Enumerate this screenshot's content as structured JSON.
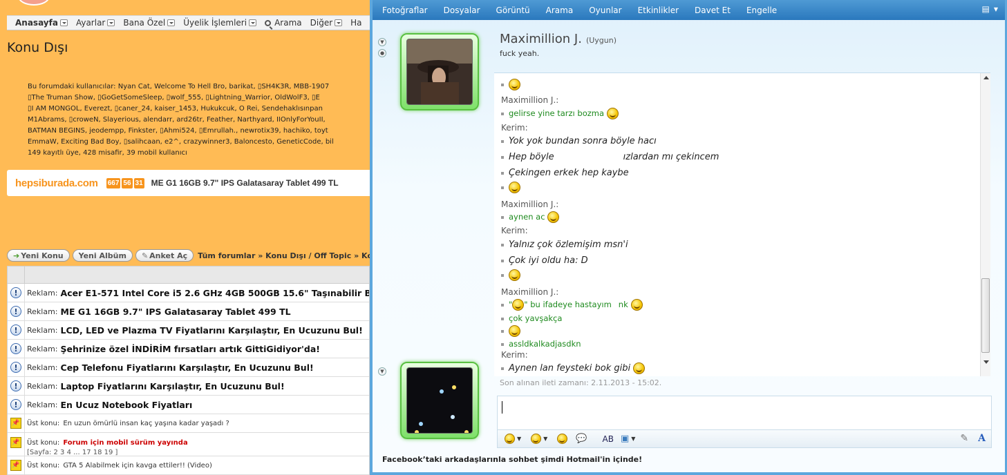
{
  "forum": {
    "nav": [
      {
        "label": "Anasayfa"
      },
      {
        "label": "Ayarlar"
      },
      {
        "label": "Bana Özel"
      },
      {
        "label": "Üyelik İşlemleri"
      },
      {
        "label": "Arama"
      },
      {
        "label": "Diğer"
      },
      {
        "label": "Ha"
      }
    ],
    "page_title": "Konu Dışı",
    "online_label": "Bu forumdaki kullanıcılar:",
    "online_lines": [
      "Nyan Cat, Welcome To Hell Bro, barikat, ▯SH4K3R, MBB-1907",
      "▯The Truman Show, ▯GoGetSomeSleep, ▯wolf_555, ▯Lightning_Warrior, OldWolF3, ▯E",
      "▯I AM MONGOL, Everezt, ▯caner_24, kaiser_1453, Hukukcuk, O Rei, Sendehaklısınpan",
      "M1Abrams, ▯croweN, Slayerious, alendarr, ard26tr, Feather, Narthyard, IIOnlyForYouII,",
      "BATMAN BEGINS, jeodempp, Finkster, ▯Ahmi524, ▯Emrullah., newrotix39, hachiko, toyt",
      "EmmaW, Exciting Bad Boy, ▯salihcaan, e2^, crazywinner3, Baloncesto, GeneticCode, bil",
      "149 kayıtlı üye, 428 misafir, 39 mobil kullanıcı"
    ],
    "ad": {
      "logo": "hepsiburada.com",
      "timer": [
        "667",
        "56",
        "31"
      ],
      "text": "ME G1 16GB 9.7\" IPS Galatasaray Tablet 499 TL"
    },
    "buttons": {
      "new_topic": "Yeni Konu",
      "new_album": "Yeni Albüm",
      "poll": "Anket Aç"
    },
    "breadcrumb": "Tüm forumlar » Konu Dışı / Off Topic » Kon",
    "ad_rows": [
      {
        "label": "Reklam:",
        "title": "Acer E1-571 Intel Core i5 2.6 GHz 4GB 500GB 15.6\" Taşınabilir Bi"
      },
      {
        "label": "Reklam:",
        "title": "ME G1 16GB 9.7\" IPS Galatasaray Tablet 499 TL"
      },
      {
        "label": "Reklam:",
        "title": "LCD, LED ve Plazma TV Fiyatlarını Karşılaştır, En Ucuzunu Bul!"
      },
      {
        "label": "Reklam:",
        "title": "Şehrinize özel İNDİRİM fırsatları artık GittiGidiyor'da!"
      },
      {
        "label": "Reklam:",
        "title": "Cep Telefonu Fiyatlarını Karşılaştır, En Ucuzunu Bul!"
      },
      {
        "label": "Reklam:",
        "title": "Laptop Fiyatlarını Karşılaştır, En Ucuzunu Bul!"
      },
      {
        "label": "Reklam:",
        "title": "En Ucuz Notebook Fiyatları"
      }
    ],
    "sticky_rows": [
      {
        "label": "Üst konu:",
        "title": "En uzun ömürlü insan kaç yaşına kadar yaşadı ?"
      },
      {
        "label": "Üst konu:",
        "title": "Forum için mobil sürüm yayında",
        "pages": "[Sayfa: 2 3 4 ... 17 18 19 ]"
      },
      {
        "label": "Üst konu:",
        "title": "GTA 5 Alabilmek için kavga ettiler!! (Video)"
      }
    ]
  },
  "messenger": {
    "menu": [
      "Fotoğraflar",
      "Dosyalar",
      "Görüntü",
      "Arama",
      "Oyunlar",
      "Etkinlikler",
      "Davet Et",
      "Engelle"
    ],
    "contact_name": "Maximillion J.",
    "contact_status": "(Uygun)",
    "personal_message": "fuck yeah.",
    "chat": {
      "s1": "Maximillion J.:",
      "m1": "gelirse yine tarzı bozma",
      "s2": "Kerim:",
      "k1": "Yok yok bundan sonra böyle hacı",
      "k2": "Hep böyle",
      "k2b": "ızlardan mı çekincem",
      "k3": "Çekingen erkek hep kaybe",
      "s3": "Maximillion J.:",
      "m2": "aynen ac",
      "s4": "Kerim:",
      "k4": "Yalnız çok özlemişim msn'i",
      "k5": "Çok iyi oldu ha: D",
      "s5": "Maximillion J.:",
      "m3a": "\"",
      "m3b": "\" bu ifadeye hastayım",
      "m3c": "nk",
      "m4": "çok yavşakça",
      "m5": "assldkalkadjasdkn",
      "s6": "Kerim:",
      "k6": "Aynen lan feysteki bok gibi"
    },
    "last_received": "Son alınan ileti zamanı: 2.11.2013 - 15:02.",
    "footer": "Facebook’taki arkadaşlarınla sohbet şimdi Hotmail'in içinde!",
    "accent": "#2a78bd"
  }
}
